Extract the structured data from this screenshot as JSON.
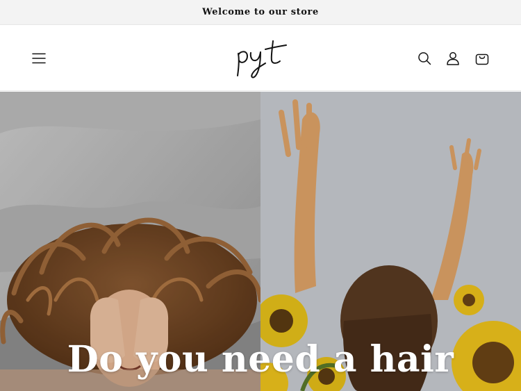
{
  "announcement": {
    "text": "Welcome to our store"
  },
  "header": {
    "logo_text": "pyt",
    "icons": {
      "menu": "hamburger-menu-icon",
      "search": "search-icon",
      "account": "user-icon",
      "cart": "shopping-bag-icon"
    }
  },
  "hero": {
    "heading": "Do you need a hair",
    "images": {
      "left": "woman lying in bed with curly hair covering her eyes",
      "right": "woman with raised arms in a sunflower field"
    }
  },
  "colors": {
    "announcement_bg": "#f3f3f3",
    "text": "#121212",
    "header_bg": "#ffffff",
    "hero_heading": "#ffffff"
  }
}
